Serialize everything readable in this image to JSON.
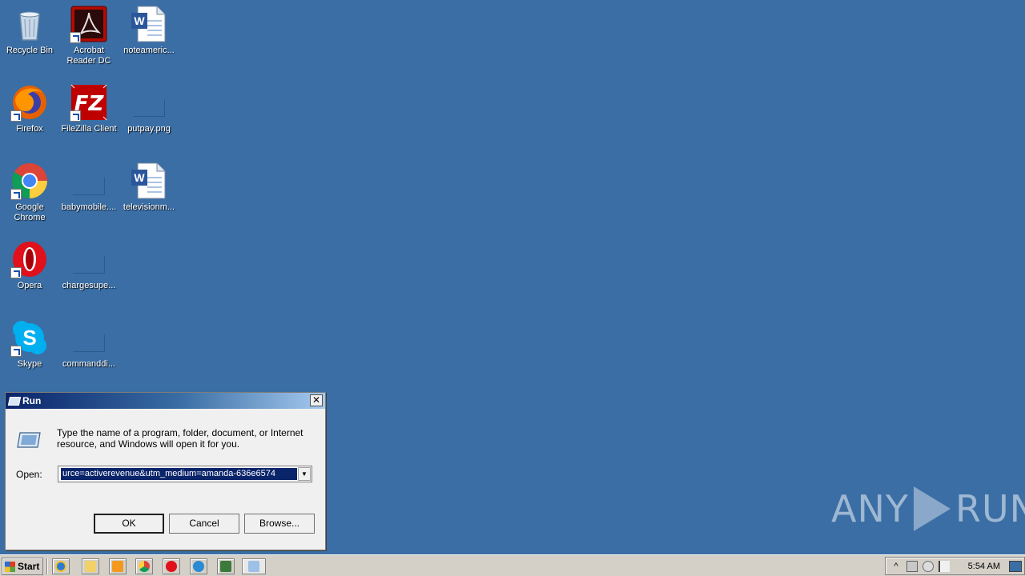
{
  "desktop": {
    "icons": [
      {
        "label": "Recycle Bin",
        "icon": "recycle-bin-icon"
      },
      {
        "label": "Acrobat Reader DC",
        "icon": "acrobat-icon"
      },
      {
        "label": "noteameric...",
        "icon": "word-doc-icon"
      },
      {
        "label": "Firefox",
        "icon": "firefox-icon"
      },
      {
        "label": "FileZilla Client",
        "icon": "filezilla-icon"
      },
      {
        "label": "putpay.png",
        "icon": "blank-file-icon"
      },
      {
        "label": "Google Chrome",
        "icon": "chrome-icon"
      },
      {
        "label": "babymobile....",
        "icon": "blank-file-icon"
      },
      {
        "label": "televisionm...",
        "icon": "word-doc-icon"
      },
      {
        "label": "Opera",
        "icon": "opera-icon"
      },
      {
        "label": "chargesupe...",
        "icon": "blank-file-icon"
      },
      {
        "label": "Skype",
        "icon": "skype-icon"
      },
      {
        "label": "commanddi...",
        "icon": "blank-file-icon"
      }
    ]
  },
  "run_dialog": {
    "title": "Run",
    "description": "Type the name of a program, folder, document, or Internet resource, and Windows will open it for you.",
    "open_label": "Open:",
    "open_value": "urce=activerevenue&utm_medium=amanda-636e6574",
    "ok_label": "OK",
    "cancel_label": "Cancel",
    "browse_label": "Browse..."
  },
  "watermark": {
    "left": "ANY",
    "right": "RUN"
  },
  "taskbar": {
    "start_label": "Start",
    "quick_launch": [
      "ie-icon",
      "explorer-icon",
      "media-player-icon",
      "chrome-icon",
      "opera-icon",
      "plus-icon",
      "task-manager-icon",
      "run-icon"
    ],
    "clock": "5:54 AM"
  },
  "colors": {
    "desktop": "#3a6ea5",
    "title_bar": "#0a246a",
    "selection": "#0a246a"
  }
}
